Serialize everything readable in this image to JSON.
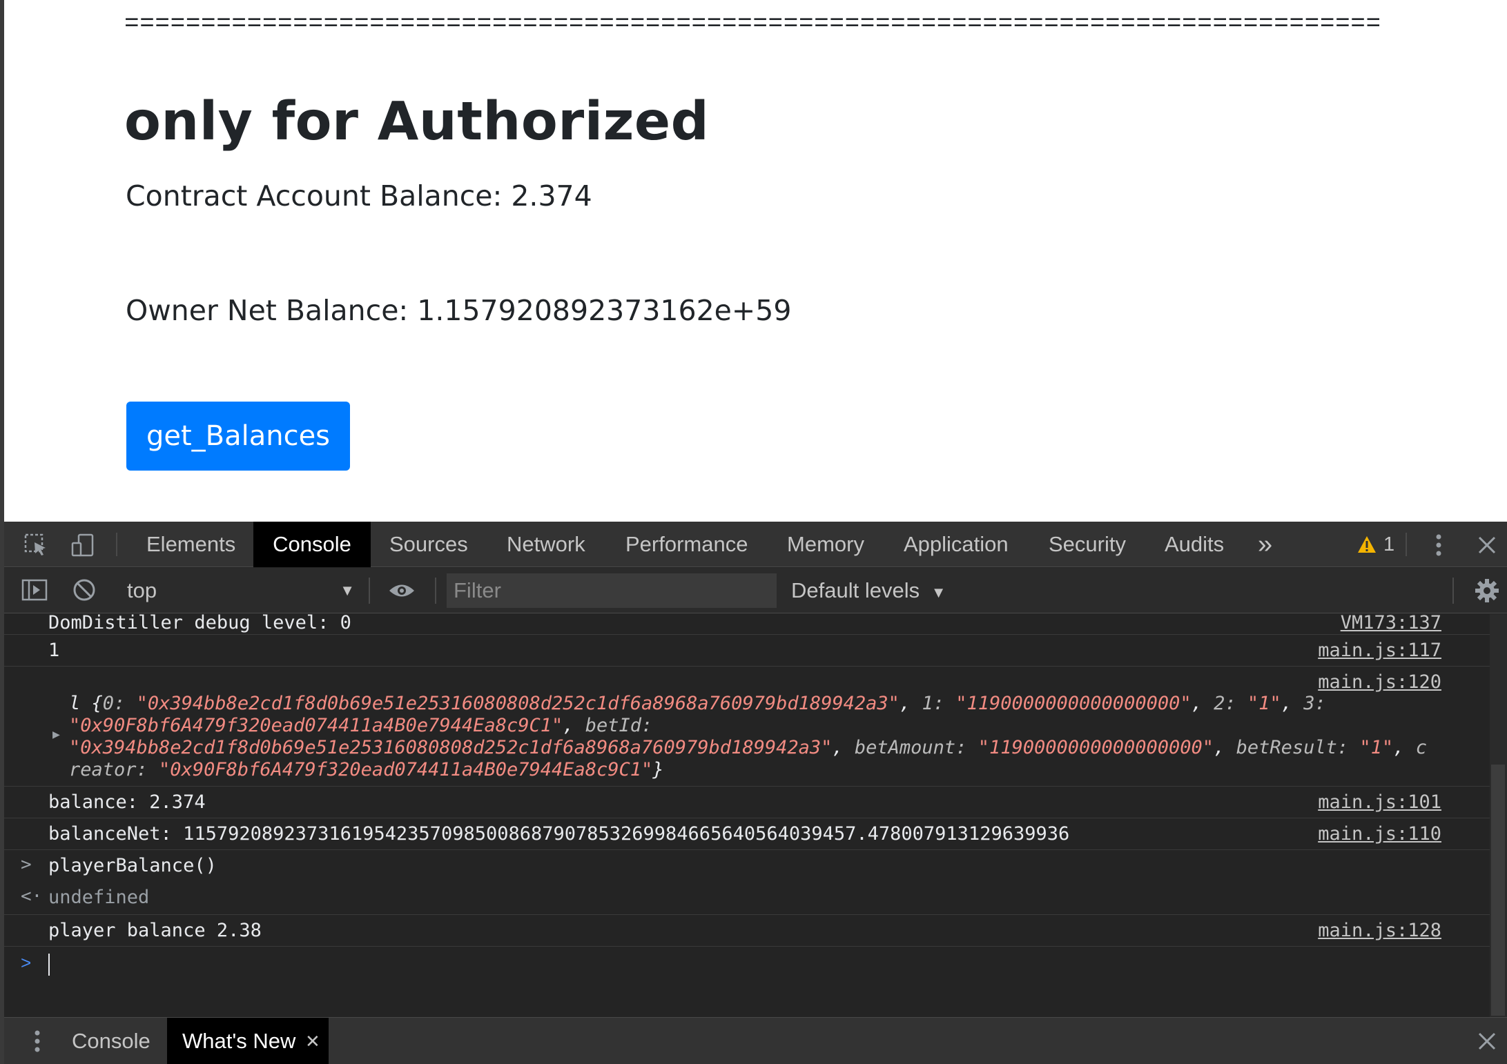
{
  "page": {
    "separator": "==================================================================================",
    "title": "only for Authorized",
    "contract_balance": "Contract Account Balance: 2.374",
    "owner_balance": "Owner Net Balance: 1.157920892373162e+59",
    "button_label": "get_Balances",
    "button_color": "#007bff"
  },
  "devtools": {
    "tabs": [
      {
        "label": "Elements"
      },
      {
        "label": "Console"
      },
      {
        "label": "Sources"
      },
      {
        "label": "Network"
      },
      {
        "label": "Performance"
      },
      {
        "label": "Memory"
      },
      {
        "label": "Application"
      },
      {
        "label": "Security"
      },
      {
        "label": "Audits"
      }
    ],
    "more_tabs_glyph": "»",
    "warning_count": "1",
    "toolbar": {
      "context": "top",
      "filter_placeholder": "Filter",
      "levels": "Default levels"
    },
    "console": {
      "logs": [
        {
          "text": "DomDistiller debug level: 0",
          "source": "VM173:137"
        },
        {
          "text": "1",
          "source": "main.js:117"
        },
        {
          "source": "main.js:120",
          "object_prefix": "l {",
          "object_lines": [
            [
              {
                "t": "0: ",
                "c": "k"
              },
              {
                "t": "\"0x394bb8e2cd1f8d0b69e51e25316080808d252c1df6a8968a760979bd189942a3\"",
                "c": "s"
              },
              {
                "t": ", ",
                "c": "p"
              },
              {
                "t": "1: ",
                "c": "k"
              },
              {
                "t": "\"1190000000000000000\"",
                "c": "s"
              },
              {
                "t": ", ",
                "c": "p"
              },
              {
                "t": "2: ",
                "c": "k"
              },
              {
                "t": "\"1\"",
                "c": "s"
              },
              {
                "t": ", ",
                "c": "p"
              },
              {
                "t": "3:",
                "c": "k"
              }
            ],
            [
              {
                "t": "\"0x90F8bf6A479f320ead074411a4B0e7944Ea8c9C1\"",
                "c": "s"
              },
              {
                "t": ", ",
                "c": "p"
              },
              {
                "t": "betId:",
                "c": "k"
              }
            ],
            [
              {
                "t": "\"0x394bb8e2cd1f8d0b69e51e25316080808d252c1df6a8968a760979bd189942a3\"",
                "c": "s"
              },
              {
                "t": ", ",
                "c": "p"
              },
              {
                "t": "betAmount: ",
                "c": "k"
              },
              {
                "t": "\"1190000000000000000\"",
                "c": "s"
              },
              {
                "t": ", ",
                "c": "p"
              },
              {
                "t": "betResult: ",
                "c": "k"
              },
              {
                "t": "\"1\"",
                "c": "s"
              },
              {
                "t": ", ",
                "c": "p"
              },
              {
                "t": "c",
                "c": "k"
              }
            ],
            [
              {
                "t": "reator: ",
                "c": "k"
              },
              {
                "t": "\"0x90F8bf6A479f320ead074411a4B0e7944Ea8c9C1\"",
                "c": "s"
              },
              {
                "t": "}",
                "c": "p"
              }
            ]
          ]
        },
        {
          "text": "balance: 2.374",
          "source": "main.js:101"
        },
        {
          "text": "balanceNet: 115792089237316195423570985008687907853269984665640564039457.478007913129639936",
          "source": "main.js:110"
        },
        {
          "text": "playerBalance()",
          "kind": "input"
        },
        {
          "text": "undefined",
          "kind": "result"
        },
        {
          "text": "player balance 2.38",
          "source": "main.js:128"
        }
      ],
      "string_color": "#f28b82",
      "prompt_color": "#4a8cf7"
    },
    "drawer": {
      "tabs": [
        {
          "label": "Console"
        },
        {
          "label": "What's New"
        }
      ]
    }
  }
}
